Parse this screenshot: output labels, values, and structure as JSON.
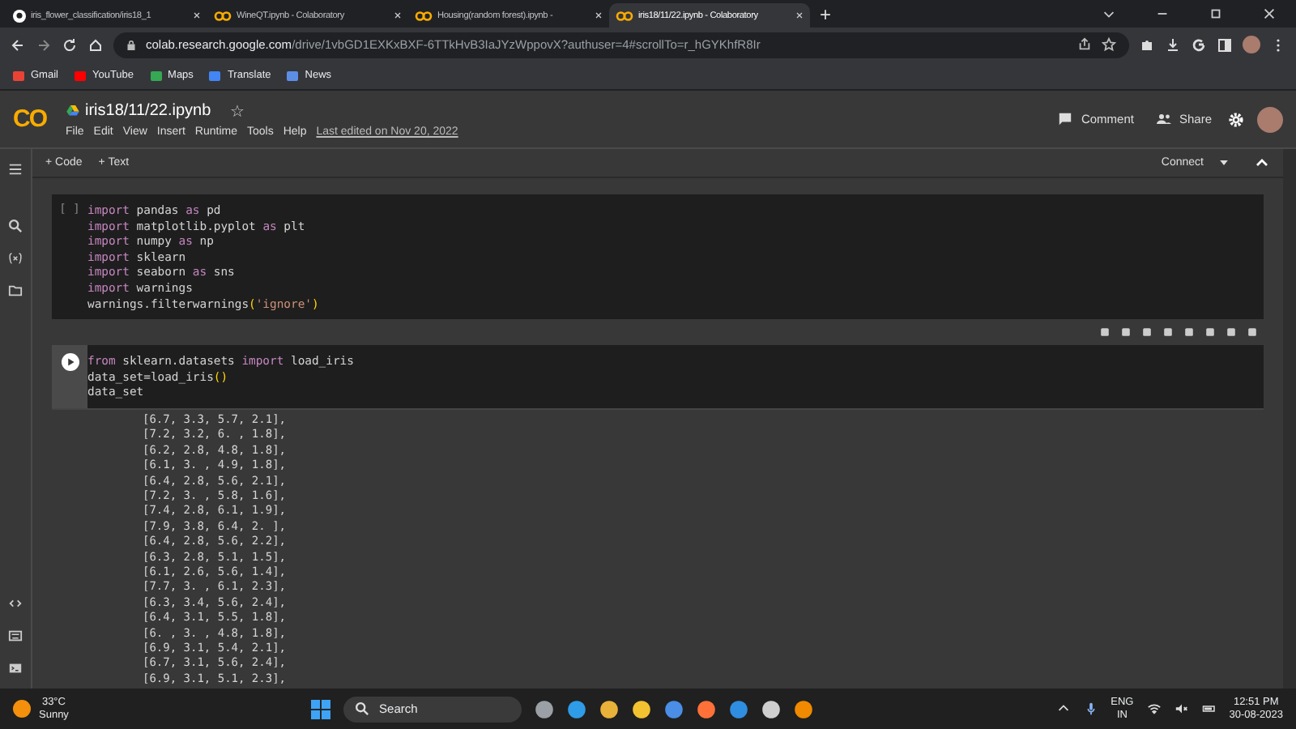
{
  "browser": {
    "tabs": [
      {
        "title": "iris_flower_classification/iris18_1",
        "kind": "github",
        "selected": false
      },
      {
        "title": "WineQT.ipynb - Colaboratory",
        "kind": "colab",
        "selected": false
      },
      {
        "title": "Housing(random forest).ipynb -",
        "kind": "colab",
        "selected": false
      },
      {
        "title": "iris18/11/22.ipynb - Colaboratory",
        "kind": "colab",
        "selected": true
      }
    ],
    "new_tab": "+",
    "url": {
      "host": "colab.research.google.com",
      "path": "/drive/1vbGD1EXKxBXF-6TTkHvB3IaJYzWppovX?authuser=4#scrollTo=r_hGYKhfR8Ir"
    },
    "bookmarks": [
      {
        "label": "Gmail",
        "color": "#ea4335"
      },
      {
        "label": "YouTube",
        "color": "#ff0000"
      },
      {
        "label": "Maps",
        "color": "#34a853"
      },
      {
        "label": "Translate",
        "color": "#4285f4"
      },
      {
        "label": "News",
        "color": "#5c8ee6"
      }
    ]
  },
  "colab": {
    "logo": "CO",
    "title": "iris18/11/22.ipynb",
    "star": "☆",
    "menu": [
      "File",
      "Edit",
      "View",
      "Insert",
      "Runtime",
      "Tools",
      "Help"
    ],
    "last_edited": "Last edited on Nov 20, 2022",
    "comment": "Comment",
    "share": "Share",
    "add_code": "+ Code",
    "add_text": "+ Text",
    "connect": "Connect"
  },
  "cells": [
    {
      "kind": "idle",
      "prompt": "[ ]",
      "lines": [
        [
          {
            "t": "import",
            "kind": "keyword"
          },
          {
            "t": " pandas ",
            "kind": "text"
          },
          {
            "t": "as",
            "kind": "keyword"
          },
          {
            "t": " pd",
            "kind": "text"
          }
        ],
        [
          {
            "t": "import",
            "kind": "keyword"
          },
          {
            "t": " matplotlib.pyplot ",
            "kind": "text"
          },
          {
            "t": "as",
            "kind": "keyword"
          },
          {
            "t": " plt",
            "kind": "text"
          }
        ],
        [
          {
            "t": "import",
            "kind": "keyword"
          },
          {
            "t": " numpy ",
            "kind": "text"
          },
          {
            "t": "as",
            "kind": "keyword"
          },
          {
            "t": " np",
            "kind": "text"
          }
        ],
        [
          {
            "t": "import",
            "kind": "keyword"
          },
          {
            "t": " sklearn",
            "kind": "text"
          }
        ],
        [
          {
            "t": "import",
            "kind": "keyword"
          },
          {
            "t": " seaborn ",
            "kind": "text"
          },
          {
            "t": "as",
            "kind": "keyword"
          },
          {
            "t": " sns",
            "kind": "text"
          }
        ],
        [
          {
            "t": "import",
            "kind": "keyword"
          },
          {
            "t": " warnings",
            "kind": "text"
          }
        ],
        [
          {
            "t": "warnings.filterwarnings",
            "kind": "text"
          },
          {
            "t": "(",
            "kind": "paren"
          },
          {
            "t": "'ignore'",
            "kind": "string"
          },
          {
            "t": ")",
            "kind": "paren"
          }
        ]
      ]
    },
    {
      "kind": "run",
      "lines": [
        [
          {
            "t": "from",
            "kind": "keyword"
          },
          {
            "t": " sklearn.datasets ",
            "kind": "text"
          },
          {
            "t": "import",
            "kind": "keyword"
          },
          {
            "t": " load_iris",
            "kind": "text"
          }
        ],
        [
          {
            "t": "data_set=load_iris",
            "kind": "text"
          },
          {
            "t": "()",
            "kind": "paren"
          }
        ],
        [
          {
            "t": "data_set",
            "kind": "text"
          }
        ]
      ],
      "output": [
        "[6.7, 3.3, 5.7, 2.1],",
        "[7.2, 3.2, 6. , 1.8],",
        "[6.2, 2.8, 4.8, 1.8],",
        "[6.1, 3. , 4.9, 1.8],",
        "[6.4, 2.8, 5.6, 2.1],",
        "[7.2, 3. , 5.8, 1.6],",
        "[7.4, 2.8, 6.1, 1.9],",
        "[7.9, 3.8, 6.4, 2. ],",
        "[6.4, 2.8, 5.6, 2.2],",
        "[6.3, 2.8, 5.1, 1.5],",
        "[6.1, 2.6, 5.6, 1.4],",
        "[7.7, 3. , 6.1, 2.3],",
        "[6.3, 3.4, 5.6, 2.4],",
        "[6.4, 3.1, 5.5, 1.8],",
        "[6. , 3. , 4.8, 1.8],",
        "[6.9, 3.1, 5.4, 2.1],",
        "[6.7, 3.1, 5.6, 2.4],",
        "[6.9, 3.1, 5.1, 2.3],"
      ]
    }
  ],
  "taskbar": {
    "weather": {
      "temp": "33°C",
      "desc": "Sunny"
    },
    "search": "Search",
    "lang": "ENG",
    "region": "IN",
    "time": "12:51 PM",
    "date": "30-08-2023"
  }
}
